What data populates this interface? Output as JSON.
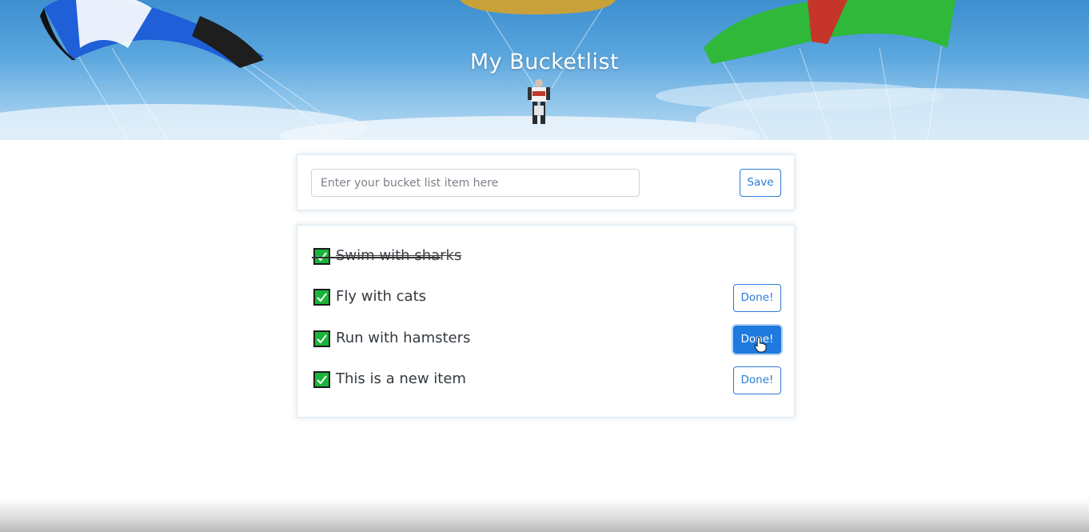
{
  "hero": {
    "title": "My Bucketlist"
  },
  "input_card": {
    "placeholder": "Enter your bucket list item here",
    "value": "",
    "save_label": "Save"
  },
  "list": {
    "items": [
      {
        "label": "Swim with sharks",
        "checked": true,
        "completed": true
      },
      {
        "label": "Fly with cats",
        "checked": true,
        "completed": false,
        "button_label": "Done!"
      },
      {
        "label": "Run with hamsters",
        "checked": true,
        "completed": false,
        "button_label": "Done!",
        "hovered": true
      },
      {
        "label": "This is a new item",
        "checked": true,
        "completed": false,
        "button_label": "Done!"
      }
    ]
  },
  "colors": {
    "accent": "#1f7ae0",
    "checkbox": "#19b53a",
    "hero_sky": "#5aa6de"
  }
}
